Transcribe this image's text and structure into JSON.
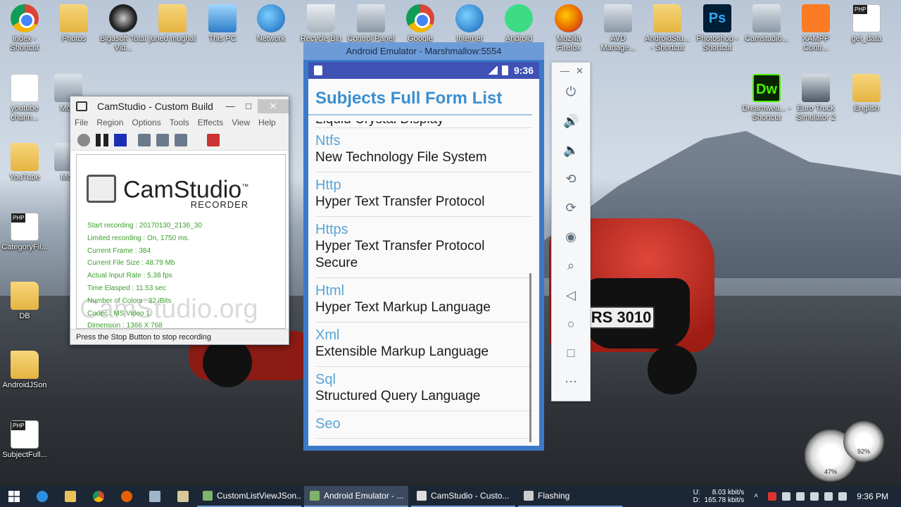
{
  "desktop": {
    "icons": [
      {
        "label": "index - Shortcut",
        "glyph": "chrome"
      },
      {
        "label": "Photos",
        "glyph": "folder"
      },
      {
        "label": "Bigasoft Total Vid...",
        "glyph": "bigasoft"
      },
      {
        "label": "juned mughal",
        "glyph": "folder"
      },
      {
        "label": "This PC",
        "glyph": "pc"
      },
      {
        "label": "Network",
        "glyph": "net"
      },
      {
        "label": "Recycle Bin",
        "glyph": "bin"
      },
      {
        "label": "Control Panel",
        "glyph": "gray"
      },
      {
        "label": "Google Chrome",
        "glyph": "chrome"
      },
      {
        "label": "Internet Download",
        "glyph": "net"
      },
      {
        "label": "Android Studio",
        "glyph": "android"
      },
      {
        "label": "Mozilla Firefox",
        "glyph": "fox"
      },
      {
        "label": "AVD Manage...",
        "glyph": "gray"
      },
      {
        "label": "AndroidStu... - Shortcut",
        "glyph": "folder"
      },
      {
        "label": "Photoshop - Shortcut",
        "glyph": "ps"
      },
      {
        "label": "Camstudio...",
        "glyph": "gray"
      },
      {
        "label": "XAMPP Contr...",
        "glyph": "xampp"
      },
      {
        "label": "get_data",
        "glyph": "php"
      },
      {
        "label": "youtube chann...",
        "glyph": "doc"
      },
      {
        "label": "Movi",
        "glyph": "gray"
      },
      {
        "label": "YouTube",
        "glyph": "folder"
      },
      {
        "label": "Mob",
        "glyph": "gray"
      },
      {
        "label": "CategoryFil...",
        "glyph": "php"
      },
      {
        "label": "DB",
        "glyph": "folder"
      },
      {
        "label": "AndroidJSon",
        "glyph": "folder"
      },
      {
        "label": "SubjectFull...",
        "glyph": "php"
      },
      {
        "label": "Dreamwea... - Shortcut",
        "glyph": "dw"
      },
      {
        "label": "Euro Truck Simulator 2",
        "glyph": "truck"
      },
      {
        "label": "English",
        "glyph": "folder"
      }
    ],
    "car_plate": "RS 3010"
  },
  "camstudio": {
    "title": "CamStudio - Custom Build",
    "menu": [
      "File",
      "Region",
      "Options",
      "Tools",
      "Effects",
      "View",
      "Help"
    ],
    "logo_name": "CamStudio",
    "logo_tm": "™",
    "logo_sub": "RECORDER",
    "stats": [
      "Start recording : 20170130_2136_30",
      "Limited recording : On, 1750 ms.",
      "Current Frame : 384",
      "Current File Size : 48.79 Mb",
      "Actual Input Rate : 5.38 fps",
      "Time Elasped : 11.53 sec",
      "Number of Colors : 32 iBits",
      "Codec : MS Video 1",
      "Dimension : 1366 X 768"
    ],
    "watermark": "CamStudio.org",
    "status": "Press the Stop Button to stop recording"
  },
  "emulator": {
    "title": "Android Emulator - Marshmallow:5554",
    "time": "9:36",
    "app_title": "Subjects Full Form List",
    "partial_top": "Liquid Crystal Display",
    "items": [
      {
        "abbr": "Ntfs",
        "full": "New Technology File System"
      },
      {
        "abbr": "Http",
        "full": "Hyper Text Transfer Protocol"
      },
      {
        "abbr": "Https",
        "full": "Hyper Text Transfer Protocol Secure"
      },
      {
        "abbr": "Html",
        "full": "Hyper Text Markup Language"
      },
      {
        "abbr": "Xml",
        "full": "Extensible Markup Language"
      },
      {
        "abbr": "Sql",
        "full": "Structured Query Language"
      },
      {
        "abbr": "Seo",
        "full": ""
      }
    ],
    "side_buttons": [
      "power",
      "volume-up",
      "volume-down",
      "rotate-left",
      "rotate-right",
      "screenshot",
      "zoom",
      "back",
      "home",
      "overview",
      "more"
    ]
  },
  "gauges": {
    "left": "47%",
    "right": "92%"
  },
  "taskbar": {
    "tasks": [
      {
        "label": "CustomListViewJSon...",
        "active": false
      },
      {
        "label": "Android Emulator - ...",
        "active": true
      },
      {
        "label": "CamStudio - Custo...",
        "active": false
      },
      {
        "label": "Flashing",
        "active": false
      }
    ],
    "net_up_label": "U:",
    "net_down_label": "D:",
    "net_up": "8.03 kbit/s",
    "net_down": "165.78 kbit/s",
    "clock": "9:36 PM"
  }
}
